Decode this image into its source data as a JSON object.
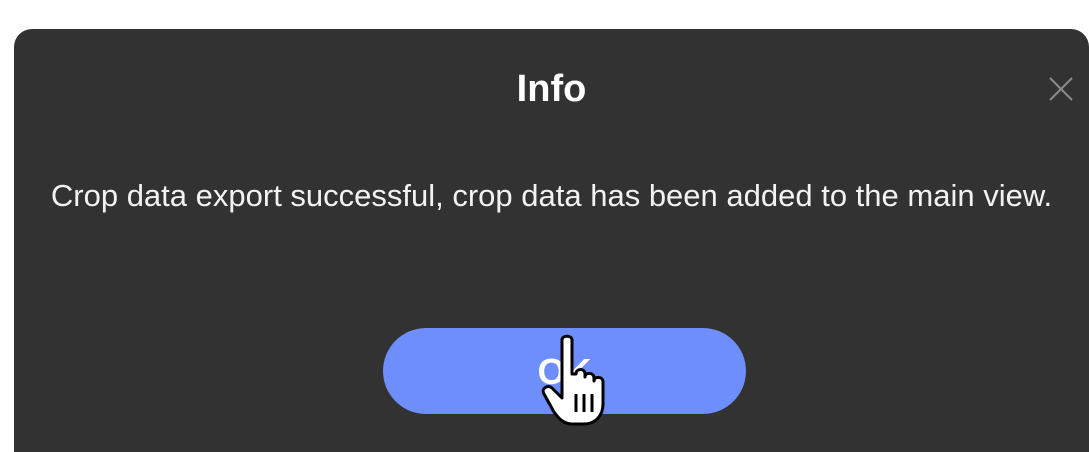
{
  "dialog": {
    "title": "Info",
    "message": "Crop data export successful, crop data has been added to the main view.",
    "ok_label": "OK",
    "close_icon": "close-icon"
  },
  "colors": {
    "dialog_bg": "#323232",
    "button_bg": "#6e8efb",
    "text": "#ffffff"
  }
}
